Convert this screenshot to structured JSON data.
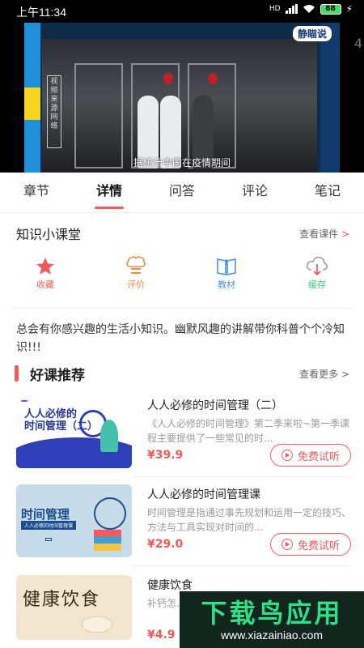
{
  "status_bar": {
    "time": "上午11:34",
    "network": "HD",
    "battery": "88"
  },
  "video": {
    "brand": "静瞄说",
    "watermark": "视频来源网络",
    "subtitle": "据统计中国在疫情期间"
  },
  "tabs": [
    {
      "label": "章节",
      "active": false
    },
    {
      "label": "详情",
      "active": true
    },
    {
      "label": "问答",
      "active": false
    },
    {
      "label": "评论",
      "active": false
    },
    {
      "label": "笔记",
      "active": false
    }
  ],
  "knowledge": {
    "title": "知识小课堂",
    "link": "查看课件",
    "arrow": ">"
  },
  "actions": [
    {
      "label": "收藏",
      "icon": "star-icon",
      "color": "#f05a5a"
    },
    {
      "label": "评价",
      "icon": "chat-icon",
      "color": "#f08a4b"
    },
    {
      "label": "教材",
      "icon": "book-icon",
      "color": "#4a8fe0"
    },
    {
      "label": "缓存",
      "icon": "download-icon",
      "color": "#3cc48a"
    }
  ],
  "description": "总会有你感兴趣的生活小知识。幽默风趣的讲解带你科普个个冷知识!!!",
  "recommend": {
    "title": "好课推荐",
    "link": "查看更多",
    "arrow": ">"
  },
  "courses": [
    {
      "title": "人人必修的时间管理（二）",
      "desc": "《人人必修的时间管理》第二季来啦~第一季课程主要提供了一些常见的时...",
      "price": "¥39.9",
      "trial": "免费试听",
      "thumb_line1": "人人必修的",
      "thumb_line2": "时间管理（二）"
    },
    {
      "title": "人人必修的时间管理课",
      "desc": "时间管理是指通过事先规划和运用一定的技巧、方法与工具实现对时间的...",
      "price": "¥29.0",
      "trial": "免费试听",
      "thumb_line1": "时间管理",
      "thumb_line2": "人人必修的时间管理课"
    },
    {
      "title": "健康饮食",
      "desc": "补钙怎... 补血怎...",
      "price": "¥4.9",
      "trial": "",
      "thumb_line1": "健康饮食",
      "thumb_line2": ""
    }
  ],
  "ad": {
    "logo": "下载鸟应用",
    "url": "www.xiazainiao.com"
  },
  "side_digit": "4"
}
